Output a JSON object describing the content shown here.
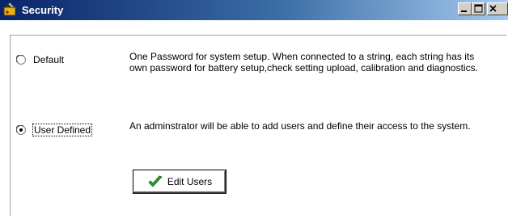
{
  "window": {
    "title": "Security",
    "icon": "battery-wrench-icon",
    "controls": {
      "minimize": "minimize-icon",
      "maximize": "maximize-icon",
      "close": "close-icon"
    }
  },
  "options": [
    {
      "label": "Default",
      "selected": false,
      "description": "One Password for system setup.  When connected to a string, each string has its own password for battery setup,check setting upload, calibration  and diagnostics."
    },
    {
      "label": "User Defined",
      "selected": true,
      "description": "An adminstrator will be able to add users and define their access to the system."
    }
  ],
  "edit_users": {
    "label": "Edit Users",
    "icon": "checkmark-icon",
    "icon_color": "#2e9e2e"
  },
  "colors": {
    "titlebar_start": "#0a246a",
    "titlebar_end": "#a6caf0"
  }
}
